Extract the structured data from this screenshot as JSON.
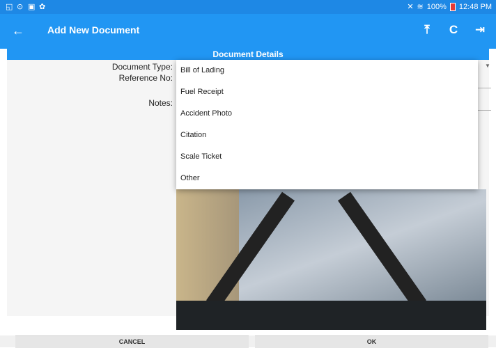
{
  "status_bar": {
    "right_text": "100%",
    "time": "12:48 PM"
  },
  "app_bar": {
    "title": "Add New Document",
    "actions": [
      "upload-icon",
      "refresh-icon",
      "logout-icon"
    ]
  },
  "section": {
    "title": "Document Details"
  },
  "form": {
    "document_type_label": "Document Type:",
    "reference_no_label": "Reference No:",
    "notes_label": "Notes:"
  },
  "dropdown": {
    "options": [
      "Bill of Lading",
      "Fuel Receipt",
      "Accident Photo",
      "Citation",
      "Scale Ticket",
      "Other"
    ]
  },
  "buttons": {
    "cancel": "CANCEL",
    "ok": "OK"
  }
}
